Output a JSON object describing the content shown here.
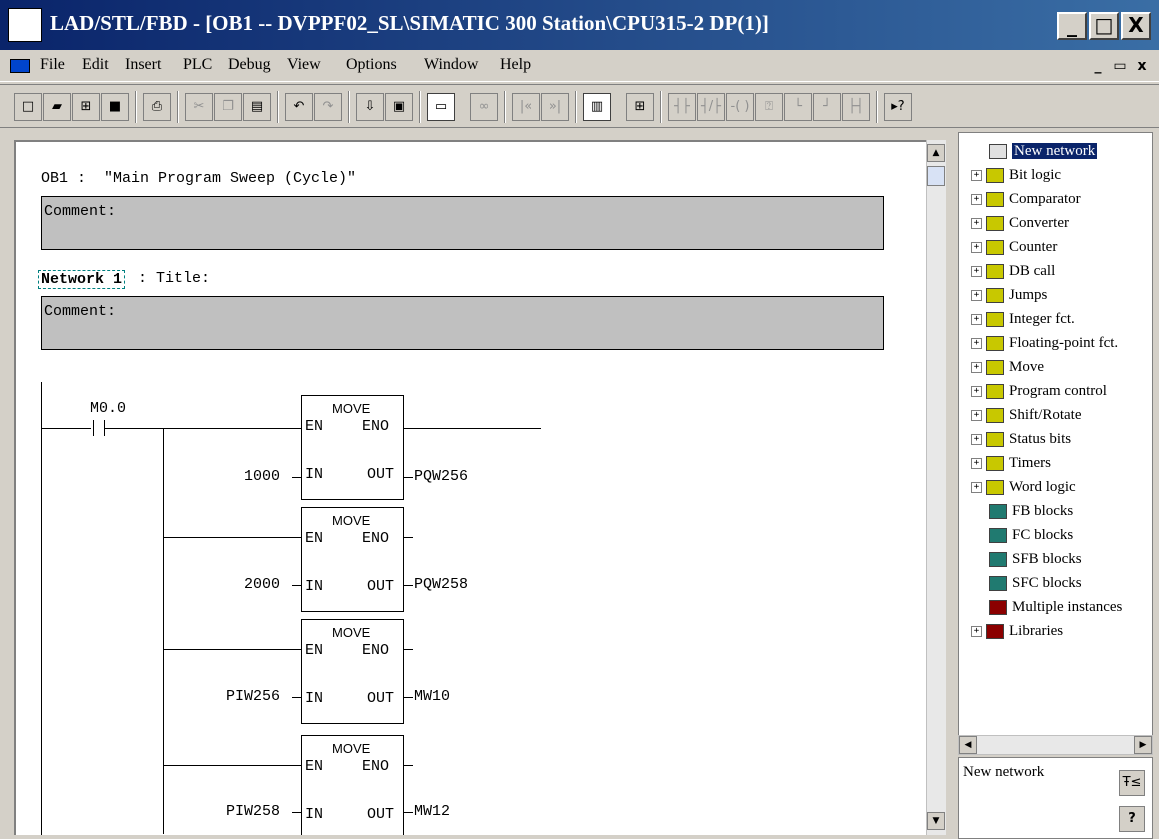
{
  "window": {
    "title": "LAD/STL/FBD  - [OB1 -- DVPPF02_SL\\SIMATIC 300 Station\\CPU315-2 DP(1)]",
    "minimize": "_",
    "maximize": "□",
    "close": "X"
  },
  "menu": {
    "items": [
      "File",
      "Edit",
      "Insert",
      "PLC",
      "Debug",
      "View",
      "Options",
      "Window",
      "Help"
    ],
    "mdi_min": "_",
    "mdi_restore": "▭",
    "mdi_close": "x"
  },
  "toolbar": {
    "buttons": [
      {
        "icon": "new-icon",
        "glyph": "□"
      },
      {
        "icon": "open-icon",
        "glyph": "▰"
      },
      {
        "icon": "accessible-nodes-icon",
        "glyph": "⊞"
      },
      {
        "icon": "save-icon",
        "glyph": "■"
      },
      {
        "icon": "print-icon",
        "glyph": "⎙"
      },
      {
        "icon": "cut-icon",
        "glyph": "✂"
      },
      {
        "icon": "copy-icon",
        "glyph": "❐"
      },
      {
        "icon": "paste-icon",
        "glyph": "▤"
      },
      {
        "icon": "undo-icon",
        "glyph": "↶"
      },
      {
        "icon": "redo-icon",
        "glyph": "↷"
      },
      {
        "icon": "download-icon",
        "glyph": "⇩"
      },
      {
        "icon": "monitor-icon",
        "glyph": "▣"
      },
      {
        "icon": "overview-icon",
        "glyph": "▭"
      },
      {
        "icon": "glasses-icon",
        "glyph": "∞"
      },
      {
        "icon": "prev-icon",
        "glyph": "|«"
      },
      {
        "icon": "next-icon",
        "glyph": "»|"
      },
      {
        "icon": "catalog-icon",
        "glyph": "▥"
      },
      {
        "icon": "new-network-icon",
        "glyph": "⊞"
      },
      {
        "icon": "contact-no-icon",
        "glyph": "┤├"
      },
      {
        "icon": "contact-nc-icon",
        "glyph": "┤/├"
      },
      {
        "icon": "coil-icon",
        "glyph": "-( )"
      },
      {
        "icon": "empty-box-icon",
        "glyph": "⍰"
      },
      {
        "icon": "open-branch-icon",
        "glyph": "└"
      },
      {
        "icon": "close-branch-icon",
        "glyph": "┘"
      },
      {
        "icon": "connection-icon",
        "glyph": "├┤"
      },
      {
        "icon": "help-context-icon",
        "glyph": "▸?"
      }
    ]
  },
  "editor": {
    "block_header": "OB1 :  \"Main Program Sweep (Cycle)\"",
    "block_comment_label": "Comment:",
    "network_label": "Network 1",
    "network_title": ": Title:",
    "network_comment_label": "Comment:",
    "contact_address": "M0.0",
    "moves": [
      {
        "name": "MOVE",
        "en": "EN",
        "eno": "ENO",
        "in_label": "IN",
        "out_label": "OUT",
        "in_value": "1000",
        "out_value": "PQW256"
      },
      {
        "name": "MOVE",
        "en": "EN",
        "eno": "ENO",
        "in_label": "IN",
        "out_label": "OUT",
        "in_value": "2000",
        "out_value": "PQW258"
      },
      {
        "name": "MOVE",
        "en": "EN",
        "eno": "ENO",
        "in_label": "IN",
        "out_label": "OUT",
        "in_value": "PIW256",
        "out_value": "MW10"
      },
      {
        "name": "MOVE",
        "en": "EN",
        "eno": "ENO",
        "in_label": "IN",
        "out_label": "OUT",
        "in_value": "PIW258",
        "out_value": "MW12"
      }
    ]
  },
  "catalog": {
    "items": [
      {
        "label": "New network",
        "expandable": false,
        "icon": "new-network-icon",
        "selected": true
      },
      {
        "label": "Bit logic",
        "expandable": true,
        "icon": "folder-icon"
      },
      {
        "label": "Comparator",
        "expandable": true,
        "icon": "folder-icon"
      },
      {
        "label": "Converter",
        "expandable": true,
        "icon": "folder-icon"
      },
      {
        "label": "Counter",
        "expandable": true,
        "icon": "folder-icon"
      },
      {
        "label": "DB call",
        "expandable": true,
        "icon": "folder-icon"
      },
      {
        "label": "Jumps",
        "expandable": true,
        "icon": "folder-icon"
      },
      {
        "label": "Integer fct.",
        "expandable": true,
        "icon": "folder-icon"
      },
      {
        "label": "Floating-point fct.",
        "expandable": true,
        "icon": "folder-icon"
      },
      {
        "label": "Move",
        "expandable": true,
        "icon": "folder-icon"
      },
      {
        "label": "Program control",
        "expandable": true,
        "icon": "folder-icon"
      },
      {
        "label": "Shift/Rotate",
        "expandable": true,
        "icon": "folder-icon"
      },
      {
        "label": "Status bits",
        "expandable": true,
        "icon": "folder-icon"
      },
      {
        "label": "Timers",
        "expandable": true,
        "icon": "folder-icon"
      },
      {
        "label": "Word logic",
        "expandable": true,
        "icon": "folder-icon"
      },
      {
        "label": "FB blocks",
        "expandable": false,
        "icon": "block-icon"
      },
      {
        "label": "FC blocks",
        "expandable": false,
        "icon": "block-icon"
      },
      {
        "label": "SFB blocks",
        "expandable": false,
        "icon": "block-icon"
      },
      {
        "label": "SFC blocks",
        "expandable": false,
        "icon": "block-icon"
      },
      {
        "label": "Multiple instances",
        "expandable": false,
        "icon": "library-icon"
      },
      {
        "label": "Libraries",
        "expandable": true,
        "icon": "library-icon"
      }
    ],
    "status_text": "New network",
    "bottom_btn1": "Ŧ≤",
    "bottom_btn2": "?"
  },
  "colors": {
    "titlebar": "#0a246a",
    "chrome": "#d4d0c8",
    "comment_bg": "#c0c0c0",
    "selection": "#0a246a"
  }
}
